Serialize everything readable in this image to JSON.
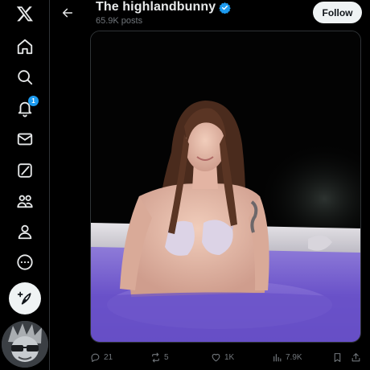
{
  "nav": {
    "items": [
      {
        "name": "x-logo-icon"
      },
      {
        "name": "home-icon"
      },
      {
        "name": "search-icon"
      },
      {
        "name": "notifications-icon",
        "badge": "1"
      },
      {
        "name": "messages-icon"
      },
      {
        "name": "grok-icon"
      },
      {
        "name": "communities-icon"
      },
      {
        "name": "profile-icon"
      },
      {
        "name": "more-icon"
      }
    ],
    "compose_icon": "feather-plus-icon"
  },
  "header": {
    "back_icon": "arrow-left-icon",
    "profile_name": "The highlandbunny",
    "verified_icon": "verified-badge-icon",
    "post_count": "65.9K posts",
    "follow_label": "Follow"
  },
  "actions": {
    "replies": "21",
    "reposts": "5",
    "likes": "1K",
    "views": "7.9K"
  },
  "colors": {
    "accent": "#1d9bf0",
    "background": "#000000",
    "text_primary": "#e7e9ea",
    "text_secondary": "#71767b",
    "button_light": "#eff3f4"
  }
}
